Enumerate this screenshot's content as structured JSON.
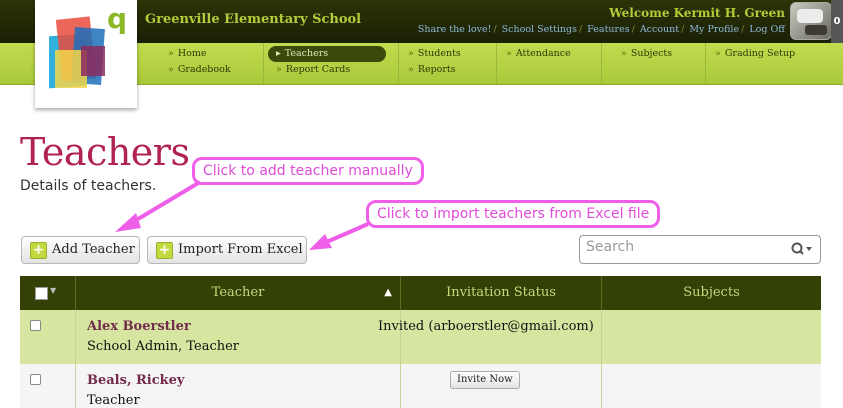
{
  "header": {
    "school_name": "Greenville Elementary School",
    "welcome": "Welcome Kermit H. Green",
    "links": [
      "Share the love!",
      "School Settings",
      "Features",
      "Account",
      "My Profile",
      "Log Off"
    ],
    "notification_count": "0"
  },
  "nav": {
    "columns": [
      [
        "Home",
        "Gradebook"
      ],
      [
        "Teachers",
        "Report Cards"
      ],
      [
        "Students",
        "Reports"
      ],
      [
        "Attendance"
      ],
      [
        "Subjects"
      ],
      [
        "Grading Setup"
      ]
    ],
    "active": "Teachers"
  },
  "page": {
    "title": "Teachers",
    "subtitle": "Details of teachers."
  },
  "callouts": {
    "add": "Click to add teacher manually",
    "import": "Click to import teachers from Excel file"
  },
  "toolbar": {
    "add_label": "Add Teacher",
    "import_label": "Import From Excel",
    "search_placeholder": "Search"
  },
  "table": {
    "headers": [
      "Teacher",
      "Invitation Status",
      "Subjects"
    ],
    "rows": [
      {
        "name": "Alex Boerstler",
        "role": "School Admin, Teacher",
        "status": "Invited (arboerstler@gmail.com)",
        "subjects": ""
      },
      {
        "name": "Beals, Rickey",
        "role": "Teacher",
        "status_button": "Invite Now",
        "subjects": ""
      }
    ]
  },
  "colors": {
    "accent": "#b0224f",
    "nav_green": "#b4d243",
    "header_dark": "#2c3408",
    "callout_pink": "#ee5ee9"
  }
}
